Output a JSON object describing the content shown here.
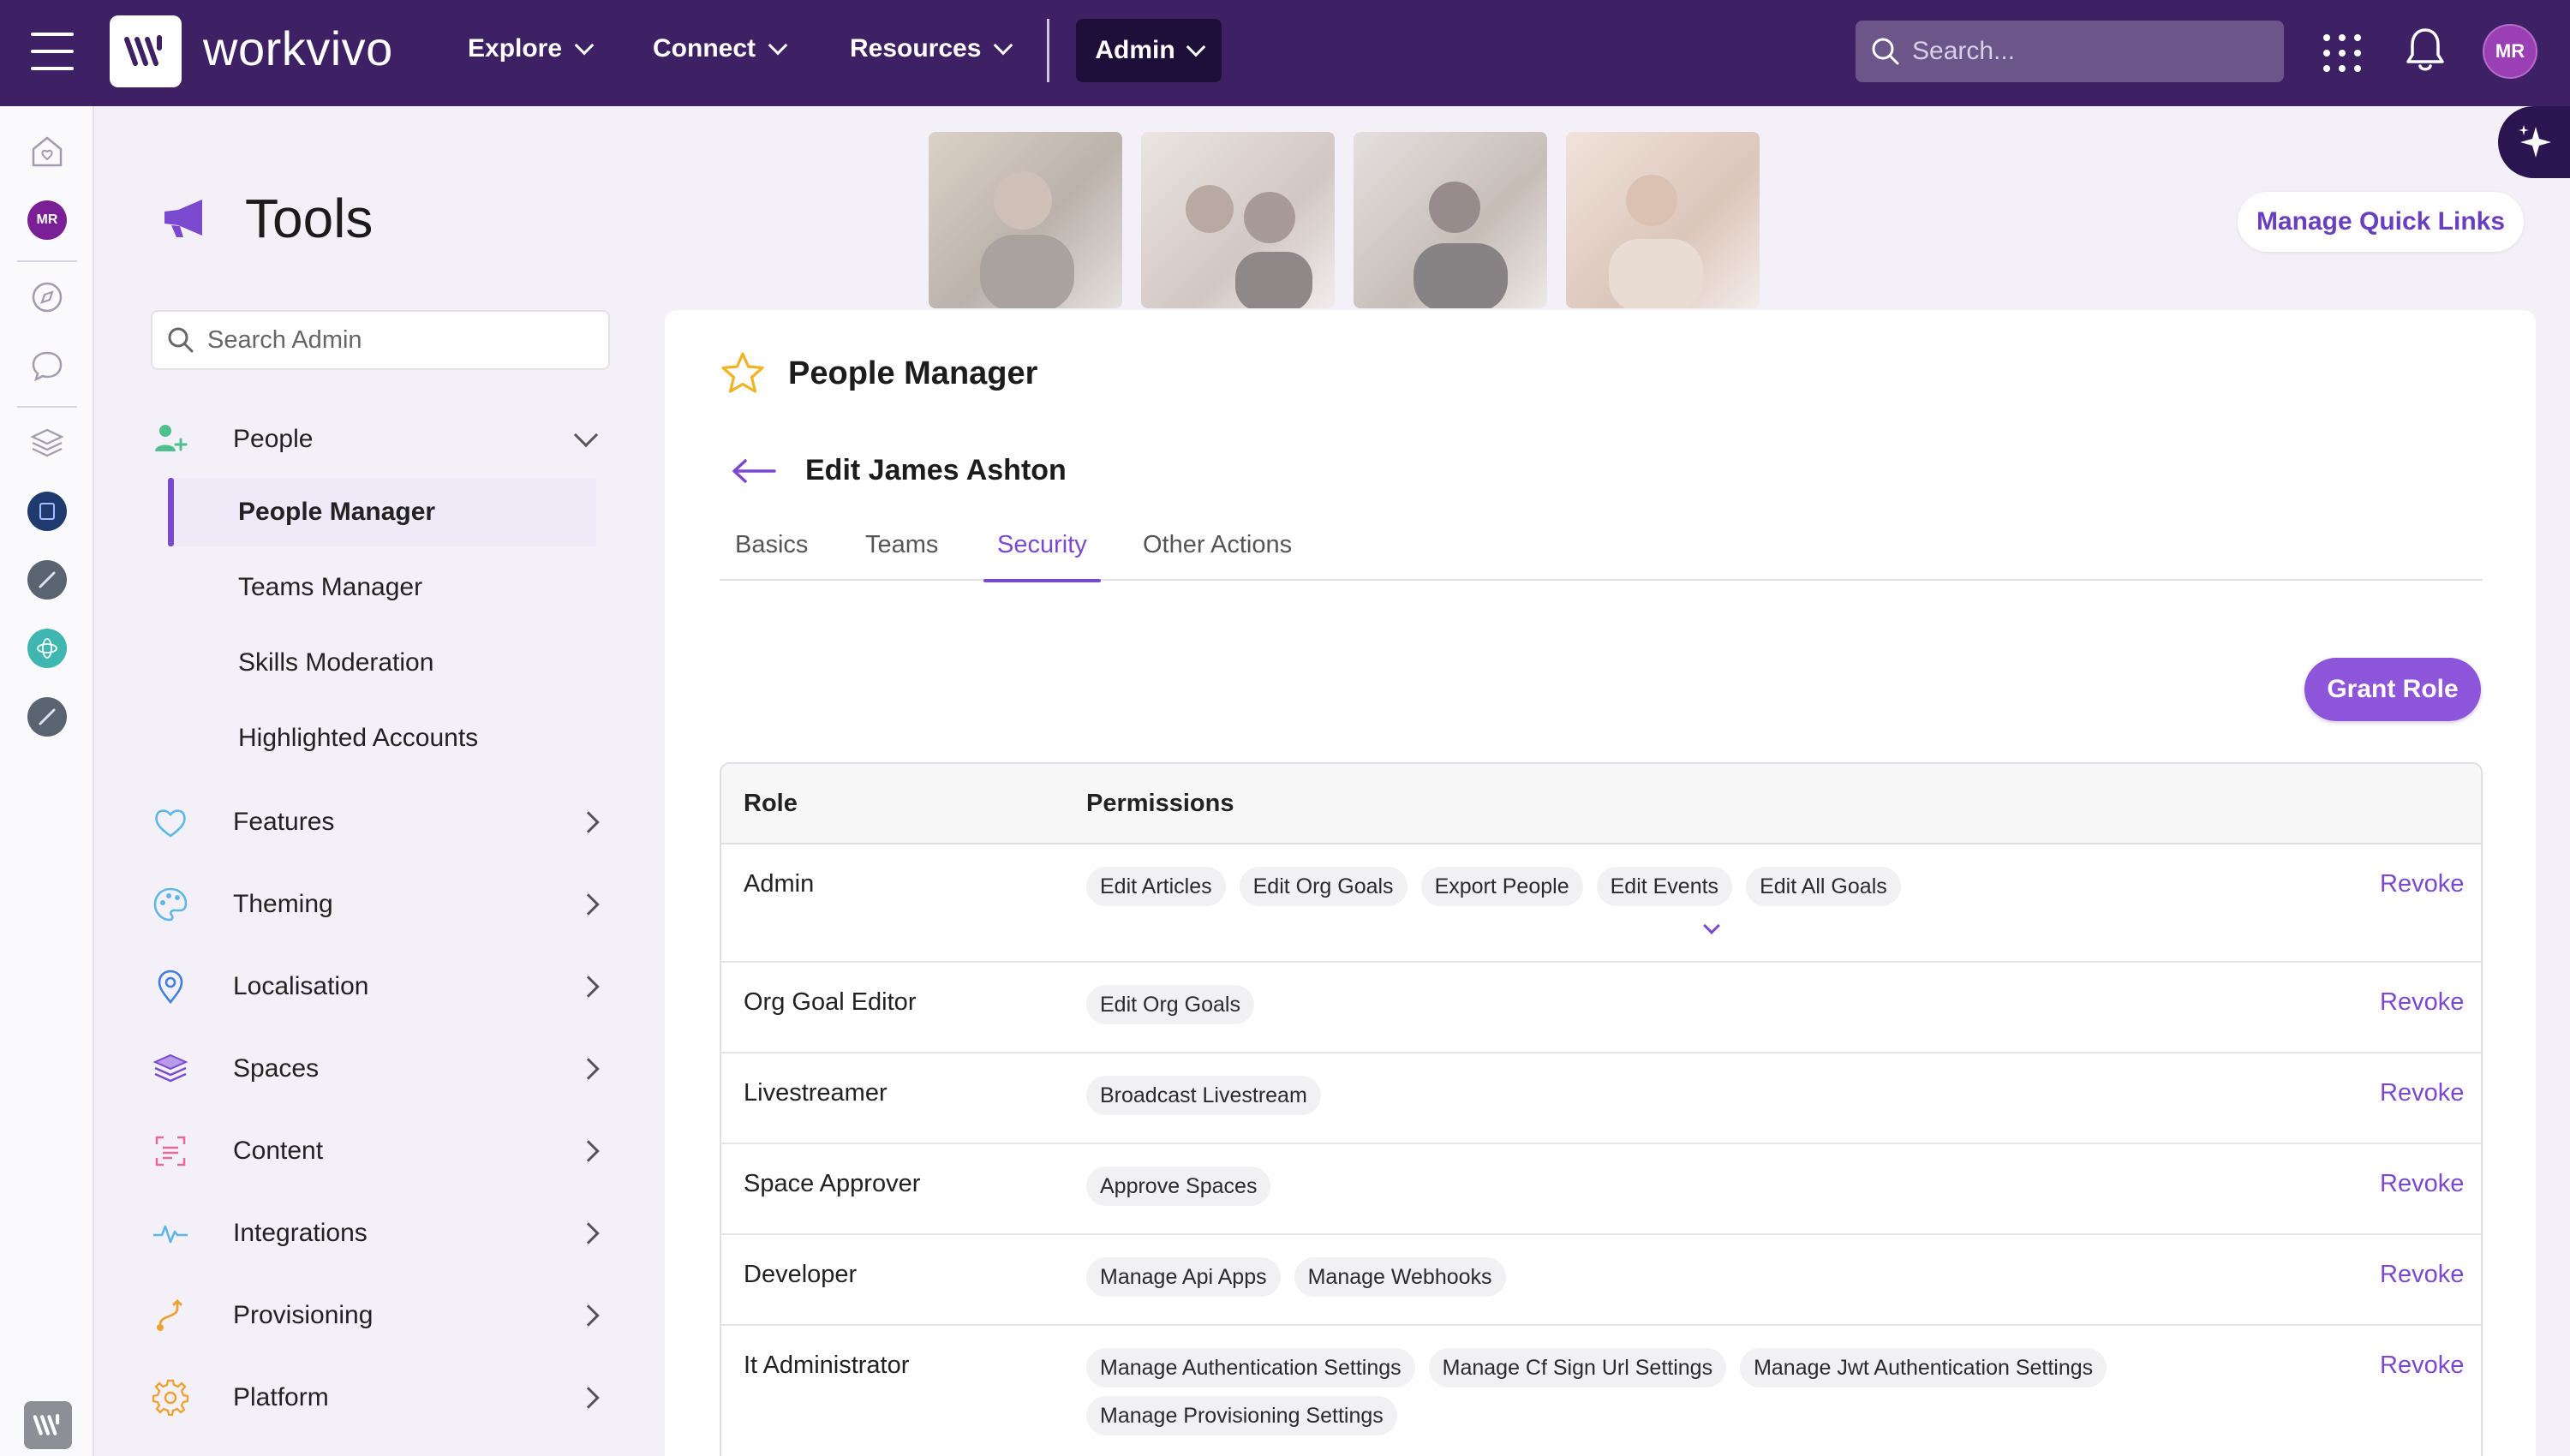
{
  "topbar": {
    "brand": "workvivo",
    "nav": [
      {
        "label": "Explore"
      },
      {
        "label": "Connect"
      },
      {
        "label": "Resources"
      }
    ],
    "admin_label": "Admin",
    "search_placeholder": "Search...",
    "avatar_initials": "MR"
  },
  "rail": {
    "avatar_initials": "MR"
  },
  "page": {
    "title": "Tools",
    "quick_links_label": "Manage Quick Links"
  },
  "sidebar": {
    "search_placeholder": "Search Admin",
    "sections": [
      {
        "label": "People",
        "icon": "person-add-icon",
        "expanded": true
      },
      {
        "label": "Features",
        "icon": "heart-icon"
      },
      {
        "label": "Theming",
        "icon": "palette-icon"
      },
      {
        "label": "Localisation",
        "icon": "location-pin-icon"
      },
      {
        "label": "Spaces",
        "icon": "layers-icon"
      },
      {
        "label": "Content",
        "icon": "content-scan-icon"
      },
      {
        "label": "Integrations",
        "icon": "pulse-icon"
      },
      {
        "label": "Provisioning",
        "icon": "route-icon"
      },
      {
        "label": "Platform",
        "icon": "gear-icon"
      }
    ],
    "people_items": [
      {
        "label": "People Manager",
        "active": true
      },
      {
        "label": "Teams Manager"
      },
      {
        "label": "Skills Moderation"
      },
      {
        "label": "Highlighted Accounts"
      }
    ]
  },
  "main": {
    "section_title": "People Manager",
    "edit_title": "Edit James Ashton",
    "tabs": [
      {
        "label": "Basics"
      },
      {
        "label": "Teams"
      },
      {
        "label": "Security",
        "active": true
      },
      {
        "label": "Other Actions"
      }
    ],
    "grant_role_label": "Grant Role",
    "table": {
      "headers": [
        "Role",
        "Permissions"
      ],
      "revoke_label": "Revoke",
      "rows": [
        {
          "role": "Admin",
          "permissions": [
            "Edit Articles",
            "Edit Org Goals",
            "Export People",
            "Edit Events",
            "Edit All Goals"
          ],
          "more": true
        },
        {
          "role": "Org Goal Editor",
          "permissions": [
            "Edit Org Goals"
          ]
        },
        {
          "role": "Livestreamer",
          "permissions": [
            "Broadcast Livestream"
          ]
        },
        {
          "role": "Space Approver",
          "permissions": [
            "Approve Spaces"
          ]
        },
        {
          "role": "Developer",
          "permissions": [
            "Manage Api Apps",
            "Manage Webhooks"
          ]
        },
        {
          "role": "It Administrator",
          "permissions": [
            "Manage Authentication Settings",
            "Manage Cf Sign Url Settings",
            "Manage Jwt Authentication Settings",
            "Manage Provisioning Settings"
          ]
        }
      ]
    }
  },
  "colors": {
    "topbar": "#3e2164",
    "accent": "#7b48d0",
    "grant_button": "#8d55d9"
  }
}
